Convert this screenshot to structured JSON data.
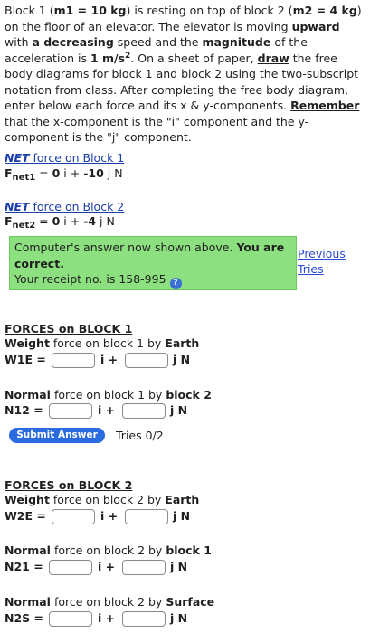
{
  "problem": {
    "p1": "Block 1 (",
    "m1": "m1 = 10 kg",
    "p2": ") is resting on top of block 2 (",
    "m2": "m2 = 4 kg",
    "p3": ") on the floor of an elevator. The elevator is moving ",
    "upward": "upward",
    "p4": " with ",
    "decreasing": "a decreasing",
    "p5": " speed and the ",
    "magnitude": "magnitude",
    "p6": " of the acceleration is ",
    "accel": "1 m/s",
    "accel_exp": "2",
    "p7": ". On a sheet of paper, ",
    "draw": "draw",
    "p8": " the free body diagrams for block 1 and block 2 using the two-subscript notation from class. After completing the free body diagram, enter below each force and its x & y-components. ",
    "remember": "Remember",
    "p9": " that the x-component is the \"i\" component and the y-component is the \"j\" component."
  },
  "net1": {
    "heading_net": "NET",
    "heading_rest": " force on Block 1",
    "sym": "F",
    "sub": "net1",
    "eq": " = ",
    "x": "0",
    "i": " i + ",
    "y": "-10",
    "j": " j",
    "unit": " N"
  },
  "net2": {
    "heading_net": "NET",
    "heading_rest": " force on Block 2",
    "sym": "F",
    "sub": "net2",
    "eq": " = ",
    "x": "0",
    "i": " i + ",
    "y": "-4",
    "j": " j",
    "unit": " N"
  },
  "answer_box": {
    "msg1": "Computer's answer now shown above. ",
    "msg_bold": "You are correct.",
    "receipt": "Your receipt no. is 158-995",
    "help_icon": "?"
  },
  "previous_tries": {
    "line1": "Previous",
    "line2": "Tries"
  },
  "block1": {
    "heading": "FORCES on BLOCK 1",
    "weight": {
      "a": "Weight",
      "b": " force on block 1 by ",
      "c": "Earth",
      "label": "W1E ="
    },
    "normal": {
      "a": "Normal",
      "b": " force on block 1 by ",
      "c": "block 2",
      "label": "N12 ="
    },
    "submit": "Submit Answer",
    "tries": "Tries 0/2"
  },
  "block2": {
    "heading": "FORCES on BLOCK 2",
    "weight": {
      "a": "Weight",
      "b": " force on block 2 by ",
      "c": "Earth",
      "label": "W2E ="
    },
    "normal1": {
      "a": "Normal",
      "b": " force on block 2 by ",
      "c": "block 1",
      "label": "N21 ="
    },
    "normal2": {
      "a": "Normal",
      "b": " force on block 2 by ",
      "c": "Surface",
      "label": "N2S ="
    }
  },
  "comp": {
    "i": "i +",
    "j": "j N"
  },
  "inputs": {
    "value": ""
  }
}
